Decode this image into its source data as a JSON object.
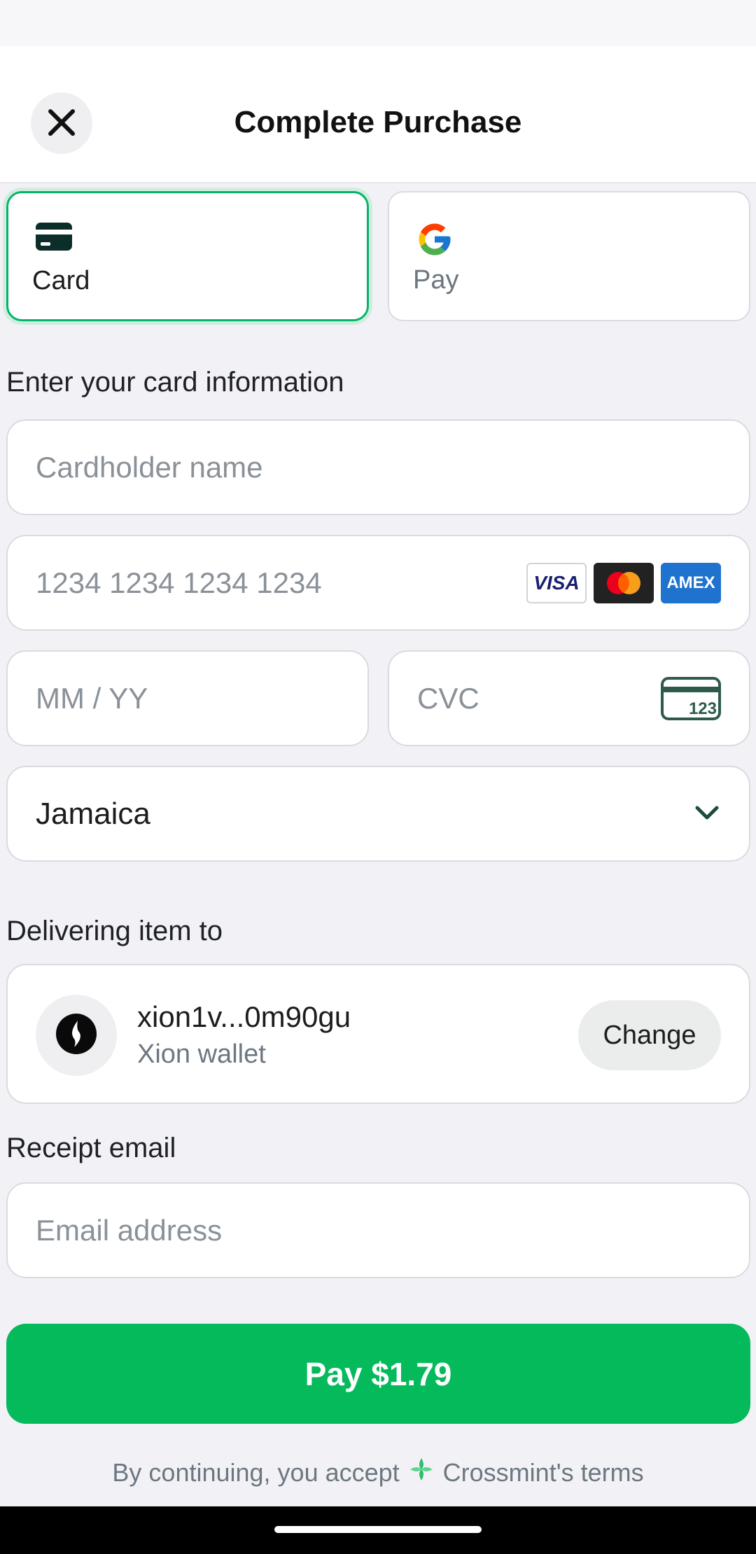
{
  "header": {
    "title": "Complete Purchase"
  },
  "payment_methods": [
    {
      "label": "Card",
      "selected": true,
      "icon": "credit-card-icon"
    },
    {
      "label": "Pay",
      "selected": false,
      "icon": "google-g-icon"
    }
  ],
  "card_form": {
    "section_label": "Enter your card information",
    "cardholder_placeholder": "Cardholder name",
    "card_number_placeholder": "1234 1234 1234 1234",
    "expiry_placeholder": "MM / YY",
    "cvc_placeholder": "CVC",
    "cvc_icon_text": "123",
    "card_brands": [
      "VISA",
      "mastercard",
      "AMEX"
    ],
    "country": "Jamaica"
  },
  "delivery": {
    "section_label": "Delivering item to",
    "wallet_address": "xion1v...0m90gu",
    "wallet_type": "Xion wallet",
    "change_label": "Change"
  },
  "receipt": {
    "section_label": "Receipt email",
    "email_placeholder": "Email address"
  },
  "pay_button": {
    "label": "Pay $1.79"
  },
  "terms": {
    "prefix": "By continuing, you accept",
    "link": "Crossmint's terms"
  },
  "colors": {
    "accent_green": "#05ba5b",
    "selected_border": "#07b36a",
    "background": "#f2f2f6"
  }
}
